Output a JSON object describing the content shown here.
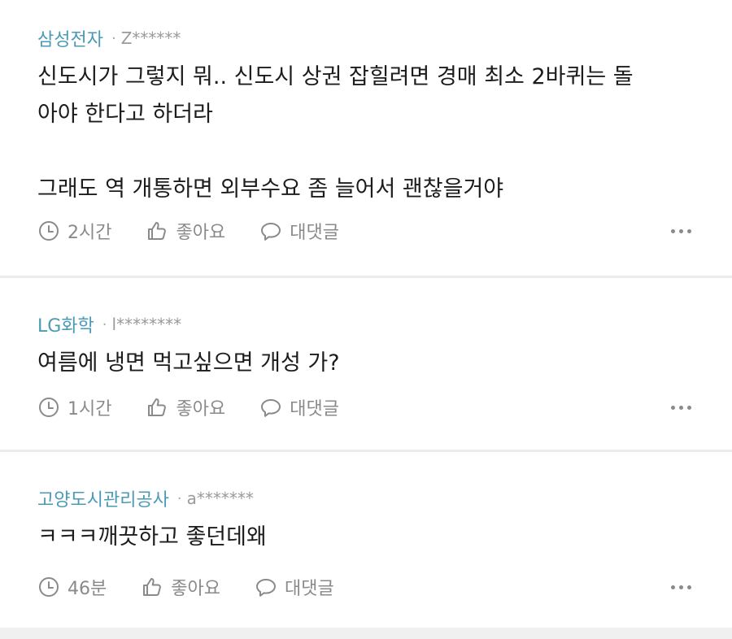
{
  "comments": [
    {
      "author": "삼성전자",
      "user": "Z******",
      "lines": [
        "신도시가 그렇지 뭐.. 신도시 상권 잡힐려면 경매 최소 2바퀴는 돌",
        "아야 한다고 하더라",
        "",
        "그래도 역 개통하면 외부수요 좀 늘어서 괜찮을거야"
      ],
      "time": "2시간",
      "like": "좋아요",
      "reply": "대댓글"
    },
    {
      "author": "LG화학",
      "user": "l********",
      "lines": [
        "여름에 냉면 먹고싶으면 개성 가?"
      ],
      "time": "1시간",
      "like": "좋아요",
      "reply": "대댓글"
    },
    {
      "author": "고양도시관리공사",
      "user": "a*******",
      "lines": [
        "ㅋㅋㅋ깨끗하고 좋던데왜"
      ],
      "time": "46분",
      "like": "좋아요",
      "reply": "대댓글"
    }
  ],
  "colors": {
    "author": "#4a9ab5",
    "text": "#1c1c1c",
    "muted": "#8a8a8a",
    "separator": "#ececec"
  },
  "icons": {
    "time": "clock-icon",
    "like": "thumbs-up-icon",
    "reply": "speech-bubble-icon",
    "more": "more-dots-icon"
  }
}
